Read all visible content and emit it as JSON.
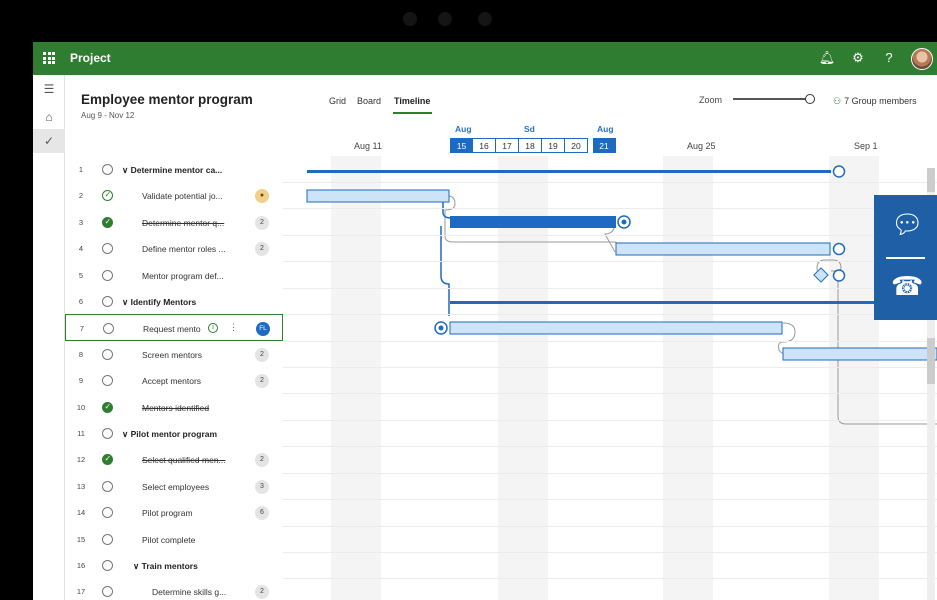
{
  "app": {
    "name": "Project"
  },
  "project": {
    "title": "Employee mentor program",
    "dates": "Aug 9 - Nov 12"
  },
  "tabs": [
    {
      "label": "Grid"
    },
    {
      "label": "Board"
    },
    {
      "label": "Timeline"
    }
  ],
  "toolbar": {
    "zoom_label": "Zoom",
    "zoom_level": 0.95,
    "members_label": "7 Group members"
  },
  "topbar_icons": [
    "bell-icon",
    "gear-icon",
    "help-icon",
    "user-avatar"
  ],
  "timeline": {
    "month_labels": [
      "Aug",
      "Sd",
      "Aug"
    ],
    "axis_labels": [
      "Aug 11",
      "Aug 25",
      "Sep 1"
    ],
    "days": [
      "15",
      "16",
      "17",
      "18",
      "19",
      "20",
      "21"
    ]
  },
  "tasks": [
    {
      "num": "1",
      "name": "Determine mentor ca...",
      "group": true,
      "status": "none",
      "badge": ""
    },
    {
      "num": "2",
      "name": "Validate potential jo...",
      "status": "progress",
      "badge": "person"
    },
    {
      "num": "3",
      "name": "Determine mentor q...",
      "status": "done",
      "badge": "2"
    },
    {
      "num": "4",
      "name": "Define mentor roles ...",
      "status": "none",
      "badge": "2"
    },
    {
      "num": "5",
      "name": "Mentor program def...",
      "status": "none",
      "badge": ""
    },
    {
      "num": "6",
      "name": "Identify Mentors",
      "group": true,
      "status": "none",
      "badge": ""
    },
    {
      "num": "7",
      "name": "Request mento",
      "status": "none",
      "badge": "FL",
      "selected": true
    },
    {
      "num": "8",
      "name": "Screen mentors",
      "status": "none",
      "badge": "2"
    },
    {
      "num": "9",
      "name": "Accept mentors",
      "status": "none",
      "badge": "2"
    },
    {
      "num": "10",
      "name": "Mentors identified",
      "status": "done",
      "badge": ""
    },
    {
      "num": "11",
      "name": "Pilot mentor program",
      "group": true,
      "status": "none",
      "badge": ""
    },
    {
      "num": "12",
      "name": "Select qualified men...",
      "status": "done",
      "badge": "2"
    },
    {
      "num": "13",
      "name": "Select employees",
      "status": "none",
      "badge": "3"
    },
    {
      "num": "14",
      "name": "Pilot program",
      "status": "none",
      "badge": "6"
    },
    {
      "num": "15",
      "name": "Pilot complete",
      "status": "none",
      "badge": ""
    },
    {
      "num": "16",
      "name": "Train mentors",
      "group": true,
      "status": "none",
      "badge": ""
    },
    {
      "num": "17",
      "name": "Determine skills g...",
      "status": "none",
      "badge": "2"
    }
  ],
  "colors": {
    "topbar": "#2f7d31",
    "accent": "#1e6ac2",
    "bar_fill": "#cde3f7"
  }
}
